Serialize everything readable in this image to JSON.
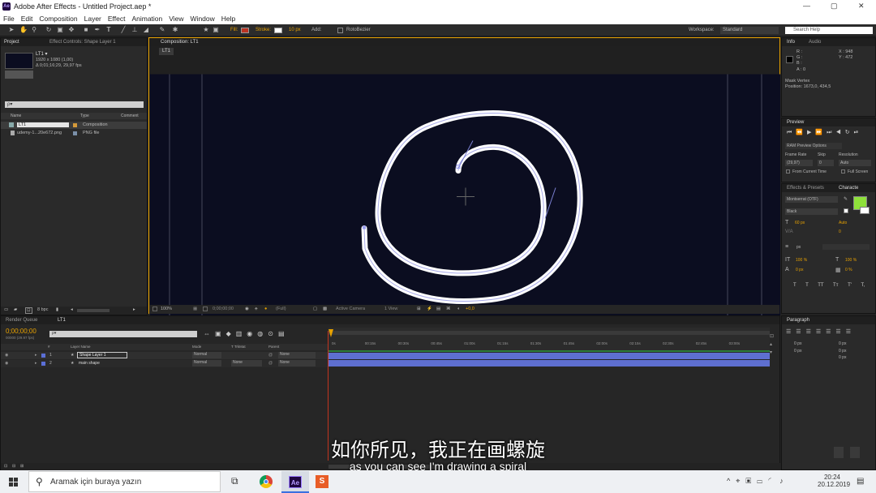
{
  "window": {
    "title": "Adobe After Effects - Untitled Project.aep *",
    "app_icon": "Ae",
    "minimize": "—",
    "maximize": "▢",
    "close": "✕"
  },
  "menu": [
    "File",
    "Edit",
    "Composition",
    "Layer",
    "Effect",
    "Animation",
    "View",
    "Window",
    "Help"
  ],
  "toolbar": {
    "fill_label": "Fill:",
    "stroke_label": "Stroke:",
    "stroke_width": "10 px",
    "add_label": "Add:",
    "rotobezier": "RotoBezier",
    "workspace_label": "Workspace:",
    "workspace_value": "Standard",
    "search_help": "Search Help"
  },
  "project_panel": {
    "tabs": [
      "Project",
      "Effect Controls: Shape Layer 1"
    ],
    "comp_name": "LT1 ▾",
    "comp_res": "1920 x 1080 (1,00)",
    "comp_dur": "Δ 0;01;16;29, 29,97 fps",
    "search_placeholder": "ρ▾",
    "columns": [
      "Name",
      "Type",
      "Comment"
    ],
    "items": [
      {
        "name": "LT1",
        "type": "Composition"
      },
      {
        "name": "udemy-1...20e672.png",
        "type": "PNG file"
      }
    ],
    "bpc": "8 bpc"
  },
  "composition": {
    "tab": "Composition: LT1",
    "sub_tab": "LT1",
    "zoom": "100%",
    "timecode": "0;00;00;00",
    "resolution": "(Full)",
    "camera": "Active Camera",
    "views": "1 View",
    "offset": "+0,0"
  },
  "info_panel": {
    "tabs": [
      "Info",
      "Audio"
    ],
    "r": "R :",
    "g": "G :",
    "b": "B :",
    "a": "A : 0",
    "x": "X : 948",
    "y": "Y : 472",
    "note1": "Mask Vertex",
    "note2": "Position: 1673,0, 434,5"
  },
  "preview_panel": {
    "tab": "Preview",
    "ram_options": "RAM Preview Options",
    "frame_rate_label": "Frame Rate",
    "skip_label": "Skip",
    "resolution_label": "Resolution",
    "frame_rate": "(29,97)",
    "skip": "0",
    "resolution": "Auto",
    "from_current": "From Current Time",
    "full_screen": "Full Screen"
  },
  "character_panel": {
    "tabs": [
      "Effects & Presets",
      "Characte"
    ],
    "font": "Montserrat (OTF)",
    "style": "Black",
    "size": "60 px",
    "leading": "Auto",
    "tracking": "0",
    "stroke": "px",
    "vscale": "100 %",
    "hscale": "100 %",
    "baseline": "0 px",
    "tsume": "0 %",
    "buttons": [
      "T",
      "T",
      "TT",
      "Tт",
      "T'",
      "T,"
    ],
    "fill_color": "#8ee03a"
  },
  "paragraph_panel": {
    "tab": "Paragraph",
    "fields": [
      "0 px",
      "0 px",
      "0 px",
      "0 px",
      "0 px"
    ]
  },
  "timeline": {
    "tabs": [
      "Render Queue",
      "LT1"
    ],
    "timecode": "0;00;00;00",
    "frame_info": "00000 (29.97 fps)",
    "columns": [
      "#",
      "Layer Name",
      "Mode",
      "T TrkMat",
      "Parent"
    ],
    "ruler": [
      "0s",
      "00:15s",
      "00:30s",
      "00:45s",
      "01:00s",
      "01:15s",
      "01:30s",
      "01:45s",
      "02:00s",
      "02:15s",
      "02:30s",
      "02:45s",
      "03:00s"
    ],
    "layers": [
      {
        "num": "1",
        "name": "Shape Layer 1",
        "mode": "Normal",
        "parent": "None"
      },
      {
        "num": "2",
        "name": "main shape",
        "mode": "Normal",
        "trkmat": "None",
        "parent": "None"
      }
    ],
    "toggle": "Toggle Switches / Modes"
  },
  "subtitle": {
    "zh": "如你所见，我正在画螺旋",
    "en": "as you can see I'm drawing a spiral"
  },
  "taskbar": {
    "search_placeholder": "Aramak için buraya yazın",
    "time": "20:24",
    "date": "20.12.2019"
  },
  "colors": {
    "comp_bg": "#0b0d20",
    "spiral": "#ffffff",
    "accent": "#e8a200"
  }
}
